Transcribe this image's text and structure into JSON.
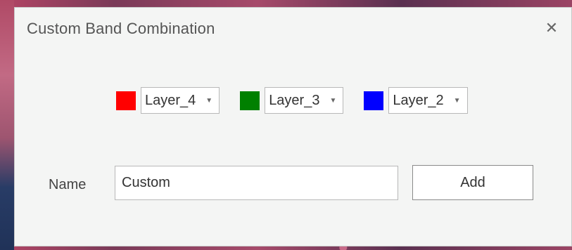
{
  "dialog": {
    "title": "Custom Band Combination",
    "close_icon": "close-icon"
  },
  "bands": [
    {
      "channel": "red",
      "color": "#ff0000",
      "selected": "Layer_4",
      "dropdown_icon": "chevron-down-icon"
    },
    {
      "channel": "green",
      "color": "#008000",
      "selected": "Layer_3",
      "dropdown_icon": "chevron-down-icon"
    },
    {
      "channel": "blue",
      "color": "#0000ff",
      "selected": "Layer_2",
      "dropdown_icon": "chevron-down-icon"
    }
  ],
  "name_field": {
    "label": "Name",
    "value": "Custom"
  },
  "add_button": {
    "label": "Add"
  },
  "glyphs": {
    "close": "✕",
    "dropdown": "▼"
  }
}
